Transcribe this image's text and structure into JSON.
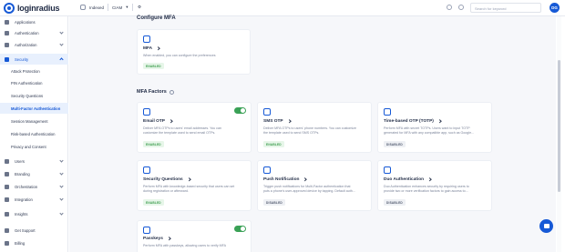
{
  "topbar": {
    "logo_text": "loginradius",
    "env_name": "Indexed",
    "env_code": "CIAM",
    "search_placeholder": "Search for keyword",
    "avatar_initials": "DG"
  },
  "sidebar": {
    "items": [
      {
        "label": "Applications",
        "icon": "grid-icon"
      },
      {
        "label": "Authentication",
        "icon": "key-icon"
      },
      {
        "label": "Authorization",
        "icon": "lock-icon"
      },
      {
        "label": "Security",
        "icon": "shield-icon"
      }
    ],
    "security_sub": [
      {
        "label": "Attack Protection"
      },
      {
        "label": "PIN Authentication"
      },
      {
        "label": "Security Questions"
      },
      {
        "label": "Multi-Factor Authentication"
      },
      {
        "label": "Session Management"
      },
      {
        "label": "Risk-based Authentication"
      },
      {
        "label": "Privacy and Consent"
      }
    ],
    "more": [
      {
        "label": "Users",
        "icon": "users-icon"
      },
      {
        "label": "Branding",
        "icon": "palette-icon"
      },
      {
        "label": "Orchestration",
        "icon": "flow-icon"
      },
      {
        "label": "Integration",
        "icon": "plug-icon"
      },
      {
        "label": "Insights",
        "icon": "chart-icon"
      },
      {
        "label": "Get Support",
        "icon": "help-icon"
      },
      {
        "label": "Billing",
        "icon": "card-icon"
      }
    ]
  },
  "main": {
    "configure_title": "Configure MFA",
    "mfa_card": {
      "title": "MFA",
      "desc": "When enabled, you can configure the preferences",
      "status": "ENABLED"
    },
    "factors_title": "MFA Factors",
    "factors": [
      {
        "title": "Email OTP",
        "desc1": "Deliver MFA OTPs to users' email addresses. You can",
        "desc2": "customize the template used to send email OTPs.",
        "status": "ENABLED",
        "toggle": true
      },
      {
        "title": "SMS OTP",
        "desc1": "Deliver MFA OTPs to users' phone numbers. You can customize",
        "desc2": "the template used to send SMS OTPs.",
        "status": "ENABLED",
        "toggle": false
      },
      {
        "title": "Time-based OTP (TOTP)",
        "desc1": "Perform MFA with secret TOTPs. Users want to input TOTP",
        "desc2": "generated for MFA with any compatible app, such as Google...",
        "status": "DISABLED",
        "toggle": false
      },
      {
        "title": "Security Questions",
        "desc1": "Perform MFA with knowledge-based security that users can set",
        "desc2": "during registration or afterward.",
        "status": "ENABLED",
        "toggle": false
      },
      {
        "title": "Push Notification",
        "desc1": "Trigger push notifications for Multi-Factor authentication that",
        "desc2": "puts a phone's user-approved device by tapping. Default auth...",
        "status": "DISABLED",
        "toggle": false
      },
      {
        "title": "Duo Authentication",
        "desc1": "Duo Authentication enhances security by requiring users to",
        "desc2": "provide two or more verification factors to gain access to...",
        "status": "DISABLED",
        "toggle": false
      },
      {
        "title": "Passkeys",
        "desc1": "Perform MFA with passkeys, allowing users to verify MFA",
        "desc2": "",
        "status": "",
        "toggle": true
      }
    ]
  },
  "colors": {
    "accent": "#1659d6",
    "enabled": "#3aa156"
  }
}
